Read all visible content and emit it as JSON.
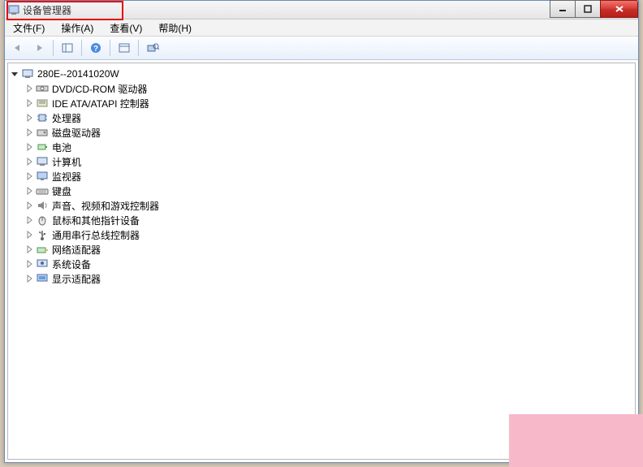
{
  "window": {
    "title": "设备管理器"
  },
  "menu": {
    "file": "文件(F)",
    "action": "操作(A)",
    "view": "查看(V)",
    "help": "帮助(H)"
  },
  "tree": {
    "root": "280E--20141020W",
    "nodes": [
      "DVD/CD-ROM 驱动器",
      "IDE ATA/ATAPI 控制器",
      "处理器",
      "磁盘驱动器",
      "电池",
      "计算机",
      "监视器",
      "键盘",
      "声音、视频和游戏控制器",
      "鼠标和其他指针设备",
      "通用串行总线控制器",
      "网络适配器",
      "系统设备",
      "显示适配器"
    ]
  }
}
